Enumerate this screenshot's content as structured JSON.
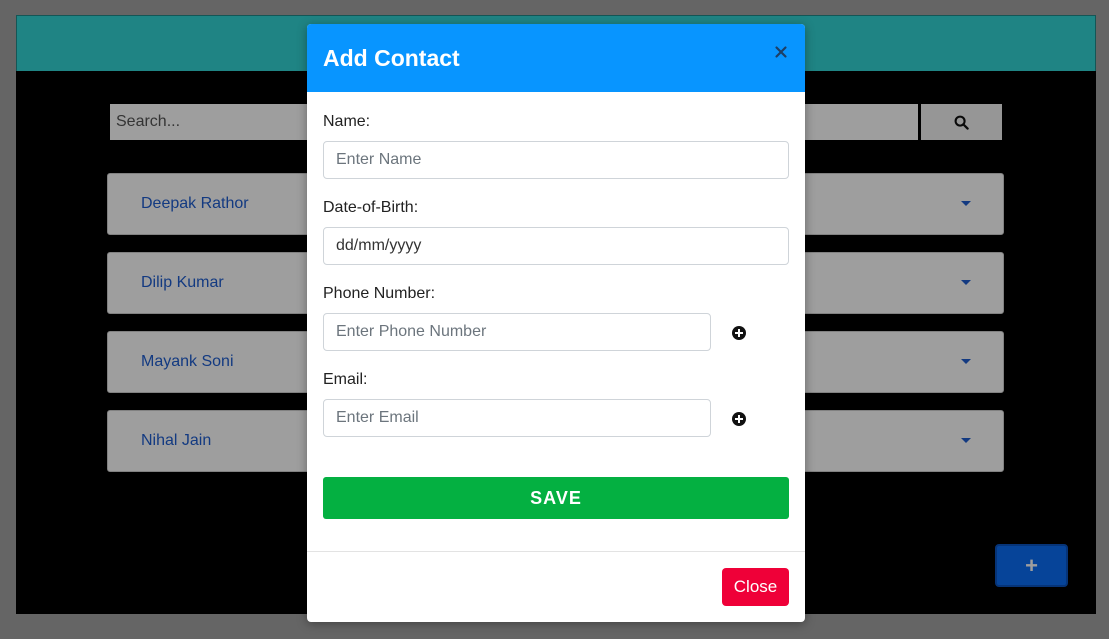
{
  "search": {
    "placeholder": "Search..."
  },
  "contacts": [
    {
      "name": "Deepak Rathor"
    },
    {
      "name": "Dilip Kumar"
    },
    {
      "name": "Mayank Soni"
    },
    {
      "name": "Nihal Jain"
    }
  ],
  "add_button": {
    "label": "+"
  },
  "modal": {
    "title": "Add Contact",
    "fields": {
      "name": {
        "label": "Name:",
        "placeholder": "Enter Name"
      },
      "dob": {
        "label": "Date-of-Birth:",
        "value": "dd/mm/yyyy"
      },
      "phone": {
        "label": "Phone Number:",
        "placeholder": "Enter Phone Number"
      },
      "email": {
        "label": "Email:",
        "placeholder": "Enter Email"
      }
    },
    "save_label": "SAVE",
    "close_label": "Close"
  },
  "colors": {
    "header_bg": "#33d6d6",
    "modal_header": "#0895ff",
    "save": "#04b041",
    "close": "#ef0038",
    "link": "#1f5ed1"
  },
  "icons": [
    "search-icon",
    "chevron-down-icon",
    "close-icon",
    "plus-circle-icon"
  ]
}
